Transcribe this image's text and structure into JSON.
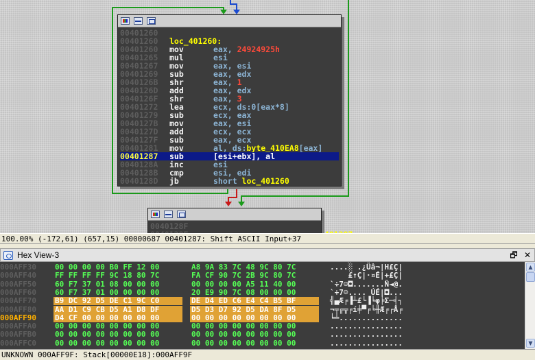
{
  "graph": {
    "main_node": {
      "lines": [
        {
          "addr": "00401260",
          "mn": "",
          "op": ""
        },
        {
          "addr": "00401260",
          "label": "loc_401260:"
        },
        {
          "addr": "00401260",
          "mn": "mov",
          "op_pre": "eax, ",
          "op_num": "24924925h"
        },
        {
          "addr": "00401265",
          "mn": "mul",
          "op": "esi"
        },
        {
          "addr": "00401267",
          "mn": "mov",
          "op": "eax, esi"
        },
        {
          "addr": "00401269",
          "mn": "sub",
          "op": "eax, edx"
        },
        {
          "addr": "0040126B",
          "mn": "shr",
          "op_pre": "eax, ",
          "op_num": "1"
        },
        {
          "addr": "0040126D",
          "mn": "add",
          "op": "eax, edx"
        },
        {
          "addr": "0040126F",
          "mn": "shr",
          "op_pre": "eax, ",
          "op_num": "3"
        },
        {
          "addr": "00401272",
          "mn": "lea",
          "op": "ecx, ds:0[eax*8]"
        },
        {
          "addr": "00401279",
          "mn": "sub",
          "op": "ecx, eax"
        },
        {
          "addr": "0040127B",
          "mn": "mov",
          "op": "eax, esi"
        },
        {
          "addr": "0040127D",
          "mn": "add",
          "op": "ecx, ecx"
        },
        {
          "addr": "0040127F",
          "mn": "sub",
          "op": "eax, ecx"
        },
        {
          "addr": "00401281",
          "mn": "mov",
          "op_pre": "al, ds:",
          "op_name": "byte_410EA8",
          "op_post": "[eax]"
        },
        {
          "addr": "00401287",
          "mn": "sub",
          "op": "[esi+ebx], al",
          "selected": true
        },
        {
          "addr": "0040128A",
          "mn": "inc",
          "op": "esi"
        },
        {
          "addr": "0040128B",
          "mn": "cmp",
          "op": "esi, edi"
        },
        {
          "addr": "0040128D",
          "mn": "jb",
          "op_pre": "short ",
          "op_name": "loc_401260"
        }
      ]
    },
    "lower_node": {
      "lines": [
        {
          "addr": "0040128F",
          "mn": "",
          "op": ""
        },
        {
          "addr": "0040128F",
          "mn": "",
          "op_name": "                 401287"
        }
      ]
    }
  },
  "status_bar": "100.00% (-172,61) (657,15) 00000687 00401287: Shift ASCII Input+37",
  "hex_panel": {
    "title": "Hex View-3",
    "restore_label": "🗗",
    "close_label": "✕",
    "rows": [
      {
        "addr": "000AFF30",
        "b1": "00 00 00 00 B0 FF 12 00",
        "b2": "A8 9A 83 7C 48 9C 80 7C",
        "ascii": "....░ .¿Üâ¬|H£Ç|"
      },
      {
        "addr": "000AFF40",
        "b1": "FF FF FF FF 9C 18 80 7C",
        "b2": "FA CF 90 7C 2B 9C 80 7C",
        "ascii": "    £↑Ç|·¤É|+£Ç|"
      },
      {
        "addr": "000AFF50",
        "b1": "60 F7 37 01 08 00 00 00",
        "b2": "00 00 00 00 A5 11 40 00",
        "ascii": "`÷7☺◘.......Ñ◄@."
      },
      {
        "addr": "000AFF60",
        "b1": "60 F7 37 01 00 00 00 00",
        "b2": "20 E9 90 7C 08 00 00 00",
        "ascii": "`÷7☺.... ÚÉ|◘..."
      },
      {
        "addr": "000AFF70",
        "b1": "B9 DC 92 D5 DE C1 9C C0",
        "b2": "DE D4 ED C6 E4 C4 B5 BF",
        "ascii": "╣▄Æ╒▐┴£└▐╘φ╞Σ─╡┐",
        "highlight": true
      },
      {
        "addr": "000AFF80",
        "b1": "AA D1 C9 CB D5 A1 D8 DF",
        "b2": "D5 D3 D7 92 D5 DA 8F D5",
        "ascii": "¬╤╔╦╒í╪▀╒╘╫Æ╒┌Å╒",
        "highlight": true
      },
      {
        "addr": "000AFF90",
        "b1": "D4 CF 00 00 00 00 00 00",
        "b2": "00 00 00 00 00 00 00 00",
        "ascii": "╘╧..............",
        "highlight_partial": true,
        "current": true
      },
      {
        "addr": "000AFFA0",
        "b1": "00 00 00 00 00 00 00 00",
        "b2": "00 00 00 00 00 00 00 00",
        "ascii": "................"
      },
      {
        "addr": "000AFFB0",
        "b1": "00 00 00 00 00 00 00 00",
        "b2": "00 00 00 00 00 00 00 00",
        "ascii": "................"
      },
      {
        "addr": "000AFFC0",
        "b1": "00 00 00 00 00 00 00 00",
        "b2": "00 00 00 00 00 00 00 00",
        "ascii": "................"
      }
    ],
    "status": "UNKNOWN 000AFF9F: Stack[00000E18]:000AFF9F"
  },
  "colors": {
    "node_bg": "#3c3c3c",
    "mnemonic": "#f2f2f2",
    "operand": "#8cb4d4",
    "number": "#ff4a3a",
    "name": "#ffff00",
    "selection": "#0c1a88",
    "hex_bytes": "#55ff55",
    "hex_highlight": "#e0a235",
    "edge_green": "#1a9a1a",
    "edge_red": "#c81818",
    "edge_blue": "#1a4ad0"
  }
}
